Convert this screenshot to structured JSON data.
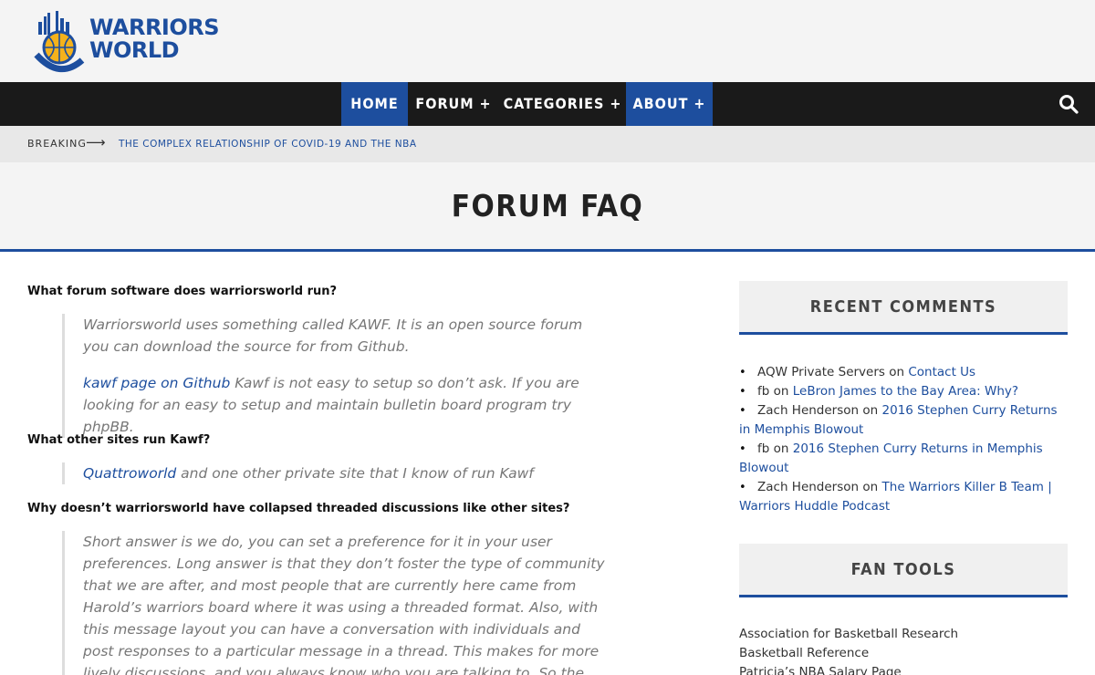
{
  "logo": {
    "line1": "WARRIORS",
    "line2": "WORLD",
    "emblem_text": "WARRIORS WORLD"
  },
  "nav": {
    "items": [
      {
        "label": "HOME",
        "active": true
      },
      {
        "label": "FORUM +",
        "active": false
      },
      {
        "label": "CATEGORIES +",
        "active": false
      },
      {
        "label": "ABOUT +",
        "active": true
      }
    ],
    "search_icon": "search-icon"
  },
  "breaking": {
    "label": "BREAKING",
    "arrow": "⟶",
    "headline": "THE COMPLEX RELATIONSHIP OF COVID-19 AND THE NBA"
  },
  "page": {
    "title": "FORUM FAQ"
  },
  "faq": [
    {
      "question": "What forum software does warriorsworld run?",
      "answer_p1": "Warriorsworld uses something called KAWF. It is an open source forum you can download the source for from Github.",
      "answer_link": "kawf page on Github",
      "answer_p2": " Kawf is not easy to setup so don’t ask. If you are looking for an easy to setup and maintain bulletin board program try phpBB."
    },
    {
      "question": "What other sites run Kawf?",
      "answer_link": "Quattroworld",
      "answer_p1": " and one other private site that I know of run Kawf"
    },
    {
      "question": "Why doesn’t warriorsworld have collapsed threaded discussions like other sites?",
      "answer_p1": "Short answer is we do, you can set a preference for it in your user preferences. Long answer is that they don’t foster the type of community that we are after, and most people that are currently here came from Harold’s warriors board where it was using a threaded format. Also, with this message layout you can have a conversation with individuals and post responses to a particular message in a thread. This makes for more lively discussions, and you always know who you are talking to. So the forum default is to not collapse threads. We also don’t use"
    }
  ],
  "sidebar": {
    "recent_comments_title": "RECENT COMMENTS",
    "comments": [
      {
        "author": "AQW Private Servers",
        "on": "on",
        "post": "Contact Us",
        "author_link": false
      },
      {
        "author": "fb",
        "on": "on",
        "post": "LeBron James to the Bay Area: Why?",
        "author_link": false
      },
      {
        "author": "Zach Henderson",
        "on": "on",
        "post": "2016 Stephen Curry Returns in Memphis Blowout",
        "author_link": false
      },
      {
        "author": "fb",
        "on": "on",
        "post": "2016 Stephen Curry Returns in Memphis Blowout",
        "author_link": false
      },
      {
        "author": "Zach Henderson",
        "on": "on",
        "post": "The Warriors Killer B Team | Warriors Huddle Podcast",
        "author_link": false
      }
    ],
    "fan_tools_title": "FAN TOOLS",
    "tools": [
      "Association for Basketball Research",
      "Basketball Reference",
      "Patricia’s NBA Salary Page"
    ]
  },
  "colors": {
    "brand_blue": "#1d4e9e",
    "nav_bg": "#1a1a1a",
    "logo_gold": "#f5b21b"
  }
}
